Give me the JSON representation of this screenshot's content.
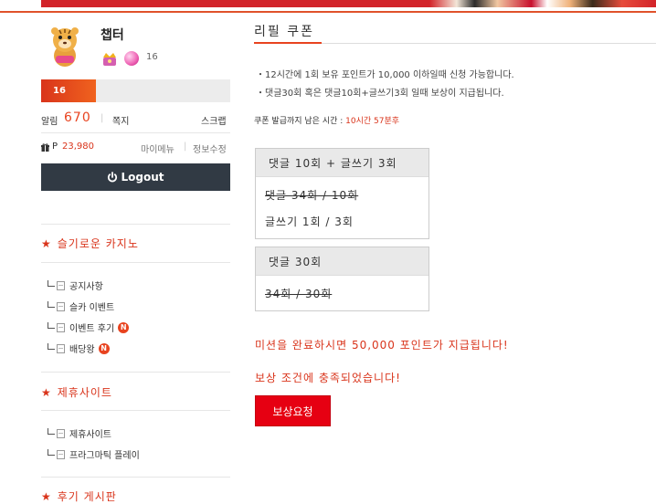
{
  "profile": {
    "username": "챕터",
    "level": "16",
    "xp_level_label": "16",
    "xp_progress": 0.29
  },
  "stats": {
    "alarm_label": "알림",
    "alarm_count": "670",
    "separator": "|",
    "memo_label": "쪽지",
    "scrap_label": "스크랩",
    "points_label": "P",
    "points_value": "23,980",
    "mymenu_label": "마이메뉴",
    "editinfo_label": "정보수정"
  },
  "logout_label": "Logout",
  "sidebar": {
    "sections": [
      {
        "title": "슬기로운 카지노",
        "items": [
          {
            "label": "공지사항",
            "badge": ""
          },
          {
            "label": "슬카 이벤트",
            "badge": ""
          },
          {
            "label": "이벤트 후기",
            "badge": "N"
          },
          {
            "label": "배당왕",
            "badge": "N"
          }
        ]
      },
      {
        "title": "제휴사이트",
        "items": [
          {
            "label": "제휴사이트",
            "badge": ""
          },
          {
            "label": "프라그마틱 플레이",
            "badge": ""
          }
        ]
      },
      {
        "title": "후기 게시판",
        "items": []
      }
    ],
    "star": "★"
  },
  "main": {
    "title": "리필 쿠폰",
    "notes": [
      "・12시간에 1회 보유 포인트가 10,000 이하일때 신청 가능합니다.",
      "・댓글30회 혹은 댓글10회+글쓰기3회 일때 보상이 지급됩니다."
    ],
    "remain_label": "쿠폰 발급까지 남은 시간 : ",
    "remain_time": "10시간 57분후",
    "box1": {
      "header": "댓글 10회 + 글쓰기 3회",
      "row1": "댓글 34회 / 10회",
      "row2": "글쓰기 1회 / 3회"
    },
    "box2": {
      "header": "댓글 30회",
      "row1": "34회 / 30회"
    },
    "mission_msg": "미션을 완료하시면 50,000 포인트가 지급됩니다!",
    "condition_msg": "보상 조건에 충족되었습니다!",
    "reward_button": "보상요청"
  },
  "colors": {
    "accent": "#d9341b",
    "button_red": "#e60012",
    "logout_bg": "#313a44"
  }
}
